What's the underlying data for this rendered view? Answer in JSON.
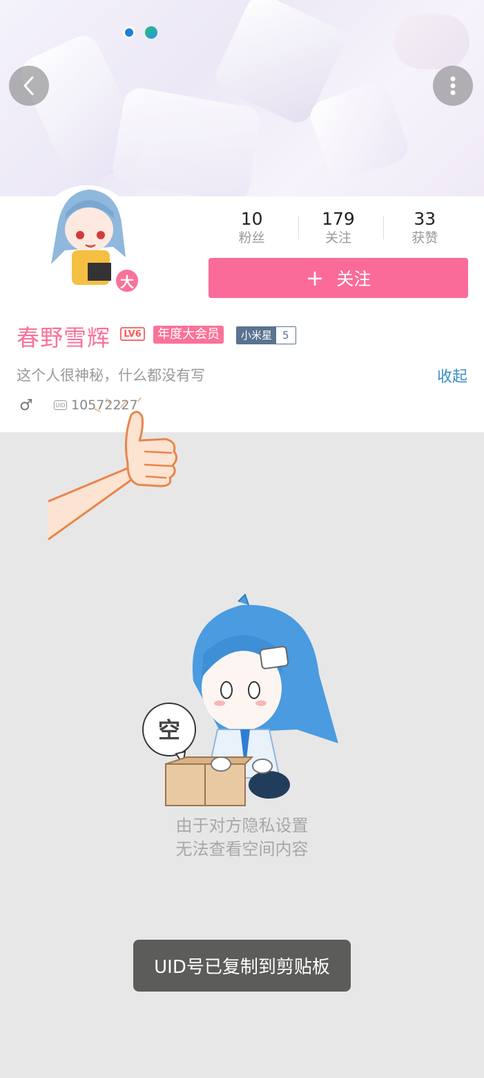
{
  "header": {
    "back_icon": "chevron-left-icon",
    "more_icon": "more-vertical-icon"
  },
  "profile": {
    "avatar_badge": "大",
    "name": "春野雪辉",
    "level_badge": "LV6",
    "vip_badge": "年度大会员",
    "mistar_label": "小米星",
    "mistar_level": "5",
    "signature": "这个人很神秘，什么都没有写",
    "collapse_label": "收起",
    "gender_symbol": "♂",
    "uid_icon_text": "UID",
    "uid": "10572227"
  },
  "stats": [
    {
      "value": "10",
      "label": "粉丝"
    },
    {
      "value": "179",
      "label": "关注"
    },
    {
      "value": "33",
      "label": "获赞"
    }
  ],
  "follow_button": {
    "plus": "+",
    "label": "关注"
  },
  "empty_state": {
    "bubble_text": "空",
    "line1": "由于对方隐私设置",
    "line2": "无法查看空间内容"
  },
  "toast": {
    "text": "UID号已复制到剪贴板"
  },
  "colors": {
    "accent_pink": "#fb7299",
    "follow_pink": "#fb6b9a",
    "link_blue": "#3a8fc9",
    "toast_bg": "#5c5c5a"
  }
}
